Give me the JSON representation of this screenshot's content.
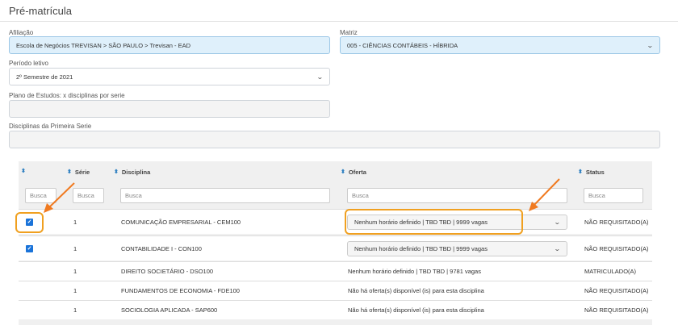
{
  "page": {
    "title": "Pré-matrícula"
  },
  "form": {
    "afiliacao": {
      "label": "Afiliação",
      "value": "Escola de Negócios TREVISAN > SÃO PAULO > Trevisan - EAD"
    },
    "matriz": {
      "label": "Matriz",
      "value": "005 - CIÊNCIAS CONTÁBEIS - HÍBRIDA"
    },
    "periodo": {
      "label": "Período letivo",
      "value": "2º Semestre de 2021"
    },
    "plano": {
      "label": "Plano de Estudos: x disciplinas por serie",
      "value": ""
    },
    "disciplinas_primeira": {
      "label": "Disciplinas da Primeira Serie",
      "value": ""
    }
  },
  "table": {
    "columns": {
      "serie": "Série",
      "disciplina": "Disciplina",
      "oferta": "Oferta",
      "status": "Status"
    },
    "filter_placeholder": "Busca",
    "rows": [
      {
        "checked": true,
        "serie": "1",
        "disciplina": "COMUNICAÇÃO EMPRESARIAL - CEM100",
        "oferta": "Nenhum horário definido | TBD TBD | 9999 vagas",
        "oferta_select": true,
        "status": "NÃO REQUISITADO(A)"
      },
      {
        "checked": true,
        "serie": "1",
        "disciplina": "CONTABILIDADE I - CON100",
        "oferta": "Nenhum horário definido | TBD TBD | 9999 vagas",
        "oferta_select": true,
        "status": "NÃO REQUISITADO(A)"
      },
      {
        "checked": false,
        "serie": "1",
        "disciplina": "DIREITO SOCIETÁRIO - DSO100",
        "oferta": "Nenhum horário definido | TBD TBD | 9781 vagas",
        "oferta_select": false,
        "status": "MATRICULADO(A)"
      },
      {
        "checked": false,
        "serie": "1",
        "disciplina": "FUNDAMENTOS DE ECONOMIA - FDE100",
        "oferta": "Não há oferta(s) disponível (is) para esta disciplina",
        "oferta_select": false,
        "status": "NÃO REQUISITADO(A)"
      },
      {
        "checked": false,
        "serie": "1",
        "disciplina": "SOCIOLOGIA APLICADA - SAP600",
        "oferta": "Não há oferta(s) disponível (is) para esta disciplina",
        "oferta_select": false,
        "status": "NÃO REQUISITADO(A)"
      }
    ]
  },
  "colors": {
    "accent": "#1a73d9",
    "highlight": "#f0a020",
    "select_blue": "#dff0fb"
  },
  "icons": {
    "sort": "sort-icon",
    "chevron": "chevron-down-icon",
    "arrow": "annotation-arrow-icon"
  }
}
